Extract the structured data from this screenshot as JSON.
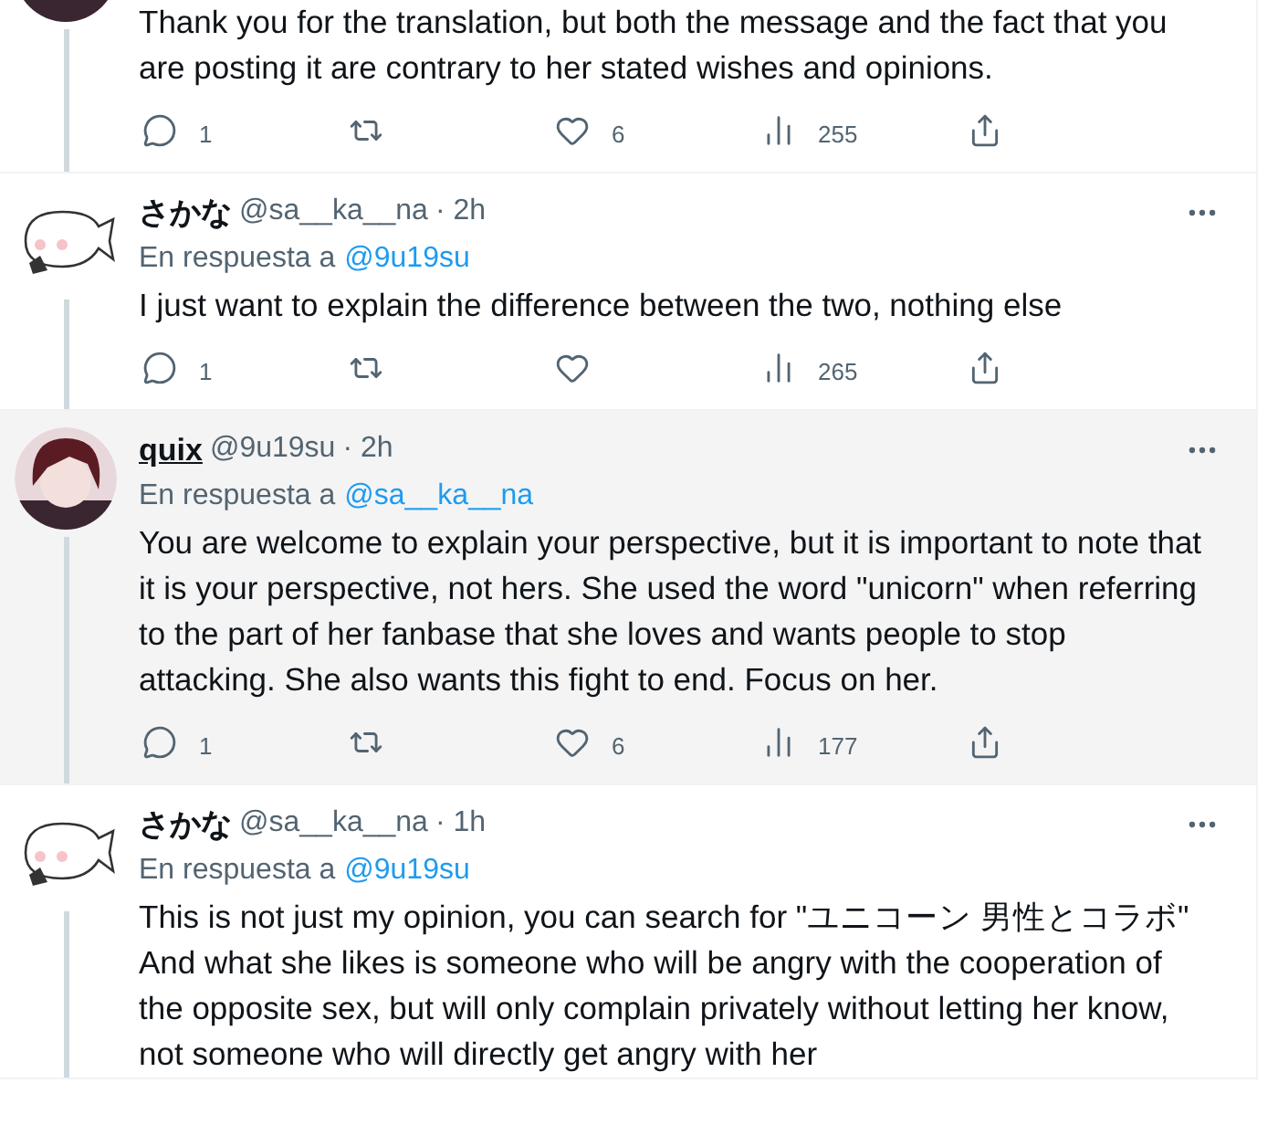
{
  "tweets": [
    {
      "kind": "character",
      "text": "Thank you for the translation, but both the message and the fact that you are posting it are contrary to her stated wishes and opinions.",
      "replies": "1",
      "likes": "6",
      "views": "255"
    },
    {
      "kind": "blob",
      "highlighted": false,
      "name": "さかな",
      "handle": "@sa__ka__na",
      "time": "· 2h",
      "reply_label": "En respuesta a",
      "reply_to": "@9u19su",
      "text": "I just want to explain the difference between the two, nothing else",
      "replies": "1",
      "views": "265"
    },
    {
      "kind": "character",
      "highlighted": true,
      "name": "quix",
      "handle": "@9u19su",
      "time": "· 2h",
      "reply_label": "En respuesta a",
      "reply_to": "@sa__ka__na",
      "text": "You are welcome to explain your perspective, but it is important to note that it is your perspective, not hers. She used the word \"unicorn\" when referring to the part of her fanbase that she loves and wants people to stop attacking. She also wants this fight to end. Focus on her.",
      "replies": "1",
      "likes": "6",
      "views": "177"
    },
    {
      "kind": "blob",
      "highlighted": false,
      "name": "さかな",
      "handle": "@sa__ka__na",
      "time": "· 1h",
      "reply_label": "En respuesta a",
      "reply_to": "@9u19su",
      "text": "This is not just my opinion, you can search for \"ユニコーン 男性とコラボ\" And what she likes is someone who will be angry with the cooperation of the opposite sex, but will only complain privately without letting her know, not someone who will directly get angry with her"
    }
  ]
}
